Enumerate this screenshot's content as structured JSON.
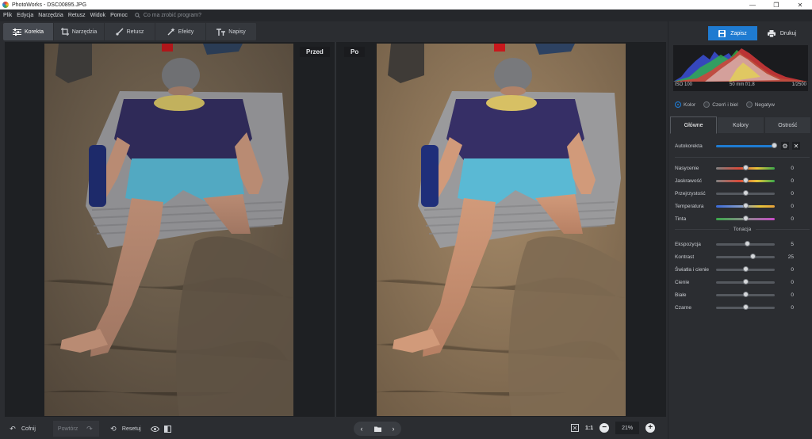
{
  "window": {
    "title": "PhotoWorks - DSC00895.JPG",
    "controls": [
      "—",
      "❐",
      "✕"
    ]
  },
  "menu": {
    "items": [
      "Plik",
      "Edycja",
      "Narzędzia",
      "Retusz",
      "Widok",
      "Pomoc"
    ],
    "search_placeholder": "Co ma zrobić program?"
  },
  "tabs": [
    {
      "label": "Korekta",
      "icon": "sliders-icon"
    },
    {
      "label": "Narzędzia",
      "icon": "crop-icon"
    },
    {
      "label": "Retusz",
      "icon": "brush-icon"
    },
    {
      "label": "Efekty",
      "icon": "magic-wand-icon"
    },
    {
      "label": "Napisy",
      "icon": "text-icon"
    }
  ],
  "viewer": {
    "before_label": "Przed",
    "after_label": "Po"
  },
  "bottom": {
    "undo": "Cofnij",
    "redo": "Powtórz",
    "reset": "Resetuj",
    "ratio": "1:1",
    "zoom": "21%"
  },
  "right": {
    "save": "Zapisz",
    "print": "Drukuj",
    "histogram": {
      "iso": "ISO 100",
      "lens": "50 mm f/1.8",
      "shutter": "1/2500"
    },
    "modes": [
      "Kolor",
      "Czerń i biel",
      "Negatyw"
    ],
    "active_mode": "Kolor",
    "panel_tabs": [
      "Główne",
      "Kolory",
      "Ostrość"
    ],
    "autocorrect": "Autokorekta",
    "section_tone": "Tonacja",
    "sliders_color": [
      {
        "label": "Nasycenie",
        "value": "0",
        "level": 0.5
      },
      {
        "label": "Jaskrawość",
        "value": "0",
        "level": 0.5
      },
      {
        "label": "Przejrzystość",
        "value": "0",
        "level": 0.5
      },
      {
        "label": "Temperatura",
        "value": "0",
        "level": 0.5
      },
      {
        "label": "Tinta",
        "value": "0",
        "level": 0.5
      }
    ],
    "sliders_tone": [
      {
        "label": "Ekspozycja",
        "value": "5",
        "level": 0.53
      },
      {
        "label": "Kontrast",
        "value": "25",
        "level": 0.62
      },
      {
        "label": "Światła i cienie",
        "value": "0",
        "level": 0.5
      },
      {
        "label": "Cienie",
        "value": "0",
        "level": 0.5
      },
      {
        "label": "Białe",
        "value": "0",
        "level": 0.5
      },
      {
        "label": "Czarne",
        "value": "0",
        "level": 0.5
      }
    ],
    "colors": {
      "accent": "#1f7bd1"
    }
  }
}
